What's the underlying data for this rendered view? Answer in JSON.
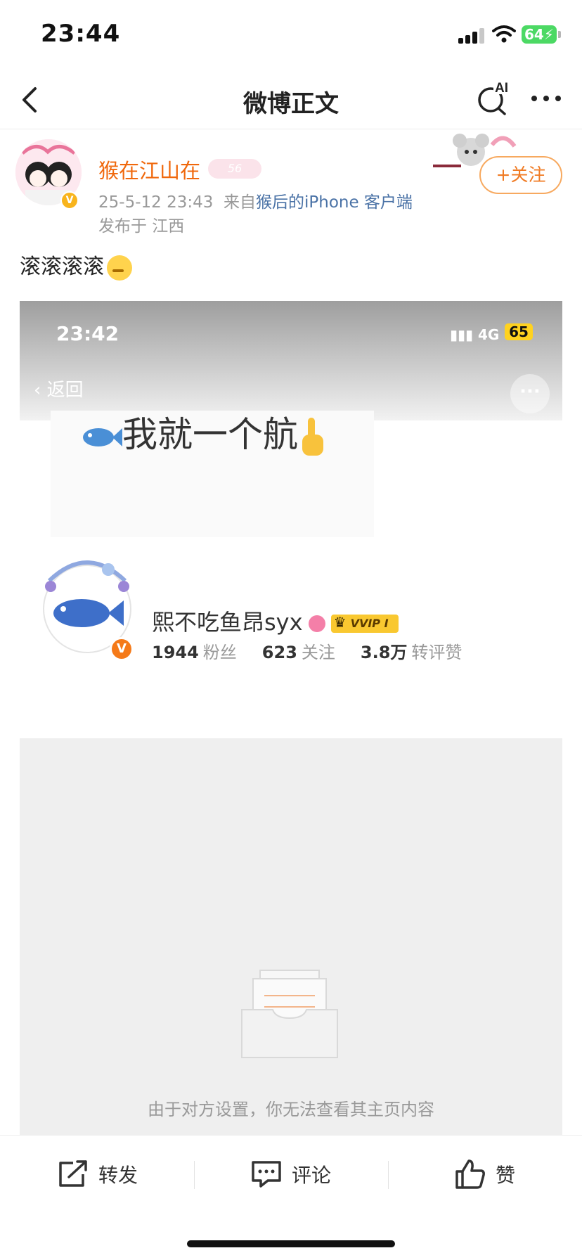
{
  "status_bar": {
    "time": "23:44",
    "battery": "64"
  },
  "nav": {
    "title": "微博正文",
    "ai_label": "AI"
  },
  "post": {
    "author_name": "猴在江山在",
    "vip_label": "56",
    "date": "25-5-12 23:43",
    "source_prefix": "来自",
    "source": "猴后的iPhone 客户端",
    "location": "发布于 江西",
    "follow_label": "+关注",
    "text": "滚滚滚滚"
  },
  "embed": {
    "time": "23:42",
    "network": "4G",
    "battery": "65",
    "back_label": "返回",
    "banner_text": "我就一个航",
    "profile": {
      "name": "熙不吃鱼昂syx",
      "vvip_label": "VVIP I",
      "stats": [
        {
          "value": "1944",
          "label": "粉丝"
        },
        {
          "value": "623",
          "label": "关注"
        },
        {
          "value": "3.8万",
          "label": "转评赞"
        }
      ]
    },
    "empty_text": "由于对方设置，你无法查看其主页内容"
  },
  "actions": {
    "repost": "转发",
    "comment": "评论",
    "like": "赞"
  },
  "colors": {
    "accent_orange": "#f07b24",
    "link_blue": "#4a72a6",
    "vip_gold": "#f9c830"
  }
}
